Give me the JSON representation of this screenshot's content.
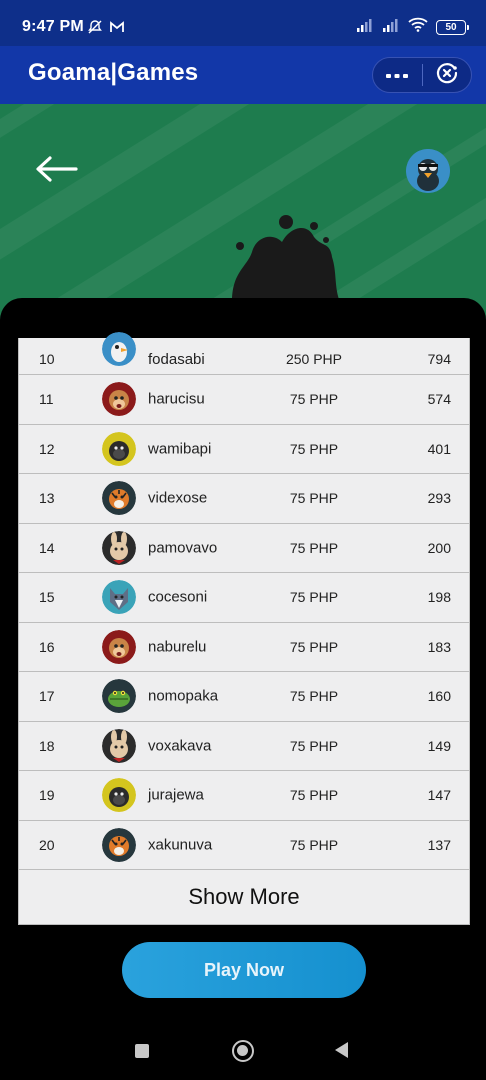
{
  "status_bar": {
    "time": "9:47 PM",
    "battery": "50",
    "icons_left": [
      "mute-icon",
      "gmail-icon"
    ],
    "icons_right": [
      "signal-icon",
      "signal-icon",
      "wifi-icon",
      "battery-icon"
    ]
  },
  "header": {
    "title": "Goama|Games",
    "more_icon": "more-horizontal-icon",
    "close_icon": "close-circle-icon",
    "color": "#1237a8"
  },
  "banner": {
    "color": "#1e7c4e",
    "back_icon": "arrow-left-icon"
  },
  "leaderboard": {
    "rows": [
      {
        "rank": "10",
        "name": "fodasabi",
        "prize": "250 PHP",
        "score": "794",
        "avatar": "bird",
        "avatar_color": "#3a8fc7"
      },
      {
        "rank": "11",
        "name": "harucisu",
        "prize": "75 PHP",
        "score": "574",
        "avatar": "monkey",
        "avatar_color": "#8b1a1a"
      },
      {
        "rank": "12",
        "name": "wamibapi",
        "prize": "75 PHP",
        "score": "401",
        "avatar": "gorilla",
        "avatar_color": "#d4c51e"
      },
      {
        "rank": "13",
        "name": "videxose",
        "prize": "75 PHP",
        "score": "293",
        "avatar": "tiger",
        "avatar_color": "#26373d"
      },
      {
        "rank": "14",
        "name": "pamovavo",
        "prize": "75 PHP",
        "score": "200",
        "avatar": "rabbit",
        "avatar_color": "#2b2b2b"
      },
      {
        "rank": "15",
        "name": "cocesoni",
        "prize": "75 PHP",
        "score": "198",
        "avatar": "wolf",
        "avatar_color": "#3aa3b8"
      },
      {
        "rank": "16",
        "name": "naburelu",
        "prize": "75 PHP",
        "score": "183",
        "avatar": "monkey",
        "avatar_color": "#8b1a1a"
      },
      {
        "rank": "17",
        "name": "nomopaka",
        "prize": "75 PHP",
        "score": "160",
        "avatar": "crocodile",
        "avatar_color": "#26373d"
      },
      {
        "rank": "18",
        "name": "voxakava",
        "prize": "75 PHP",
        "score": "149",
        "avatar": "rabbit",
        "avatar_color": "#2b2b2b"
      },
      {
        "rank": "19",
        "name": "jurajewa",
        "prize": "75 PHP",
        "score": "147",
        "avatar": "gorilla",
        "avatar_color": "#d4c51e"
      },
      {
        "rank": "20",
        "name": "xakunuva",
        "prize": "75 PHP",
        "score": "137",
        "avatar": "tiger",
        "avatar_color": "#26373d"
      }
    ],
    "show_more_label": "Show More"
  },
  "play_now_label": "Play Now",
  "nav_bar": {
    "icons": [
      "recents-icon",
      "home-icon",
      "back-icon"
    ]
  }
}
